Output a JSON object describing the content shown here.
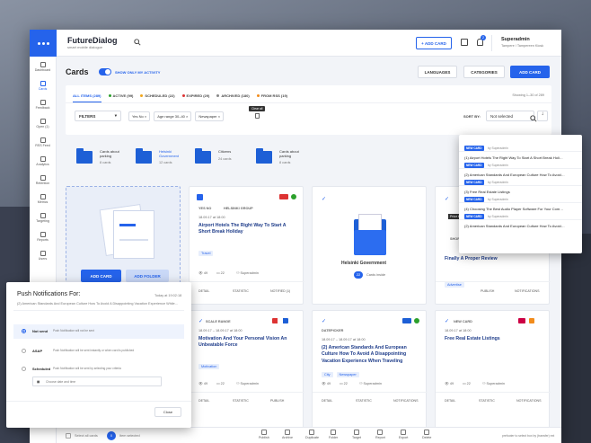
{
  "app": {
    "name": "FutureDialog",
    "tagline": "smart mobile dialogue"
  },
  "sidebar": [
    {
      "label": "Dashboard",
      "active": false
    },
    {
      "label": "Cards",
      "active": true
    },
    {
      "label": "Feedback",
      "active": false
    },
    {
      "label": "Open (1)",
      "active": false
    },
    {
      "label": "RSS Feed",
      "active": false
    },
    {
      "label": "Analytics",
      "active": false
    },
    {
      "label": "Retention",
      "active": false
    },
    {
      "label": "Metrics",
      "active": false
    },
    {
      "label": "Targeting",
      "active": false
    },
    {
      "label": "Reports",
      "active": false
    },
    {
      "label": "Users",
      "active": false
    }
  ],
  "header": {
    "add_card": "+ ADD CARD",
    "badge": "2",
    "user_name": "Superadmin",
    "user_sub": "Tampere / Tampereen Kiosk"
  },
  "page": {
    "title": "Cards",
    "toggle_label": "SHOW ONLY MY ACTIVITY",
    "languages": "LANGUAGES",
    "categories": "CATEGORIES",
    "add_card": "ADD CARD"
  },
  "tabs": [
    {
      "label": "ALL ITEMS (289)",
      "active": true
    },
    {
      "label": "ACTIVE (99)"
    },
    {
      "label": "SCHEDULED (22)"
    },
    {
      "label": "EXPIRED (29)"
    },
    {
      "label": "ARCHIVED (180)"
    },
    {
      "label": "FROM RSS (19)"
    }
  ],
  "showing": "Showing 1–30 of 289",
  "filters": {
    "filters_label": "FILTERS",
    "chips": [
      "Yes No",
      "Age range 30–40",
      "Newspaper"
    ],
    "clear_all": "Clear all",
    "sort_label": "SORT BY:",
    "sort_value": "Not selected"
  },
  "folders": [
    {
      "name": "Cards about parking",
      "count": "8 cards"
    },
    {
      "name": "Helsinki Government",
      "count": "12 cards"
    },
    {
      "name": "Citizens",
      "count": "24 cards"
    },
    {
      "name": "Cards about parking",
      "count": "8 cards"
    }
  ],
  "empty_card": {
    "add_card": "ADD CARD",
    "add_folder": "ADD FOLDER"
  },
  "cards": [
    {
      "org": "YES NO",
      "org2": "HELSINKI GROUP",
      "date": "18.09.17 at 18:00",
      "title": "Airport Hotels The Right Way To Start A Short Break Holiday",
      "tag": "Travel",
      "views": "49",
      "comments": "22",
      "author": "Superadmin",
      "actions": [
        "DETAIL",
        "STATISTIC",
        "NOTIFIED (1)"
      ]
    },
    {
      "title": "Helsinki Government",
      "count": "22",
      "count_label": "Cards inside"
    },
    {
      "org": "SHORT",
      "title": "Finally A Proper Review",
      "tag": "Advertise",
      "actions": [
        "PUBLISH",
        "NOTIFICATIONS"
      ]
    },
    {
      "org": "SCALE RANGE",
      "date": "18.09.17 – 18.09.17 at 18:00",
      "title": "Motivation And Your Personal Vision An Unbeatable Force",
      "tag": "Motivation",
      "views": "49",
      "comments": "22",
      "author": "Superadmin",
      "actions": [
        "DETAIL",
        "STATISTIC",
        "PUBLISH"
      ]
    },
    {
      "org": "DATEPICKER",
      "date": "18.09.17 – 18.09.17 at 18:00",
      "title": "(2) American Standards And European Culture How To Avoid A Disappointing Vacation Experience When Traveling",
      "tags": [
        "City",
        "Newspaper"
      ],
      "views": "49",
      "comments": "22",
      "author": "Superadmin",
      "actions": [
        "DETAIL",
        "STATISTIC",
        "NOTIFICATIONS"
      ]
    },
    {
      "org": "NEW CARD",
      "date": "18.09.17 at 18:00",
      "title": "Free Real Estate Listings",
      "views": "49",
      "comments": "22",
      "author": "Superadmin",
      "actions": [
        "DETAIL",
        "STATISTIC",
        "NOTIFICATIONS"
      ]
    }
  ],
  "notif_popup": [
    {
      "badge": "NEW CARD",
      "by": "by Superadmin",
      "title": "(1) Airport Hotels The Right Way To Start A Short Break Holi…"
    },
    {
      "badge": "NEW CARD",
      "by": "by Superadmin",
      "title": "(2) American Standards And European Culture How To Avoid…"
    },
    {
      "badge": "NEW CARD",
      "by": "by Superadmin",
      "title": "(3) Free Real Estate Listings"
    },
    {
      "badge": "NEW CARD",
      "by": "by Superadmin",
      "title": "(4) Choosing The Best Audio Player Software For Your Com…"
    },
    {
      "badge": "NEW CARD",
      "by": "by Superadmin",
      "title": "(2) American Standards And European Culture How To Avoid…"
    }
  ],
  "push": {
    "title": "Push Notifications For:",
    "date": "Today at 19:02:18",
    "subtitle": "(2) American Standards And European Culture How To Avoid A Disappointing Vacation Experience While…",
    "options": [
      {
        "label": "Not send",
        "desc": "Push Notification will not be sent"
      },
      {
        "label": "ASAP",
        "desc": "Push Notification will be sent instantly or when card is published"
      },
      {
        "label": "Scheduled",
        "desc": "Push Notification will be sent by selecting your criteria"
      }
    ],
    "date_placeholder": "Choose date and time",
    "close": "Close"
  },
  "bottom": {
    "select_all": "Select all cards",
    "selected_count": "0",
    "selected_label": "Item selected",
    "actions": [
      "Publish",
      "Archive",
      "Duplicate",
      "Folder",
      "Target",
      "Report",
      "Export",
      "Delete"
    ],
    "footer": "prefooter to select box by (transfer) ext"
  }
}
